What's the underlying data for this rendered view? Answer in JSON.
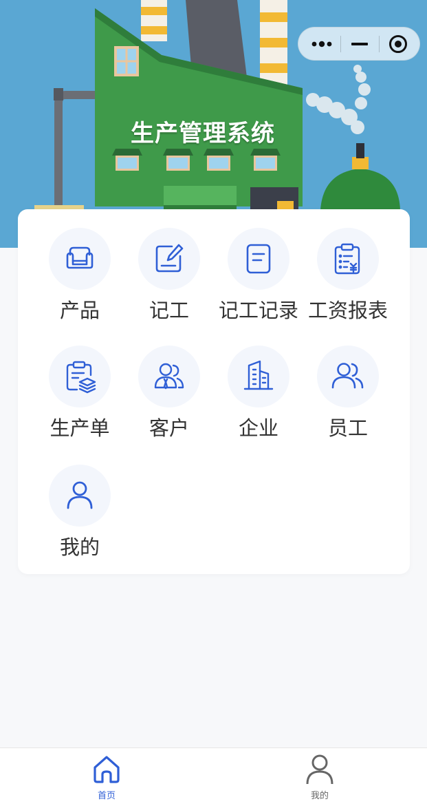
{
  "banner": {
    "title": "生产管理系统"
  },
  "colors": {
    "accent": "#2f5fd6",
    "tab_inactive": "#666666",
    "sky": "#5aa7d3",
    "factory": "#3f9a4a"
  },
  "menu": {
    "items": [
      {
        "label": "产品",
        "icon": "sofa-icon"
      },
      {
        "label": "记工",
        "icon": "edit-note-icon"
      },
      {
        "label": "记工记录",
        "icon": "document-icon"
      },
      {
        "label": "工资报表",
        "icon": "salary-report-icon"
      },
      {
        "label": "生产单",
        "icon": "production-order-icon"
      },
      {
        "label": "客户",
        "icon": "customers-icon"
      },
      {
        "label": "企业",
        "icon": "building-icon"
      },
      {
        "label": "员工",
        "icon": "staff-icon"
      },
      {
        "label": "我的",
        "icon": "user-icon"
      }
    ]
  },
  "tabbar": {
    "items": [
      {
        "label": "首页",
        "icon": "home-icon",
        "active": true
      },
      {
        "label": "我的",
        "icon": "profile-icon",
        "active": false
      }
    ]
  }
}
